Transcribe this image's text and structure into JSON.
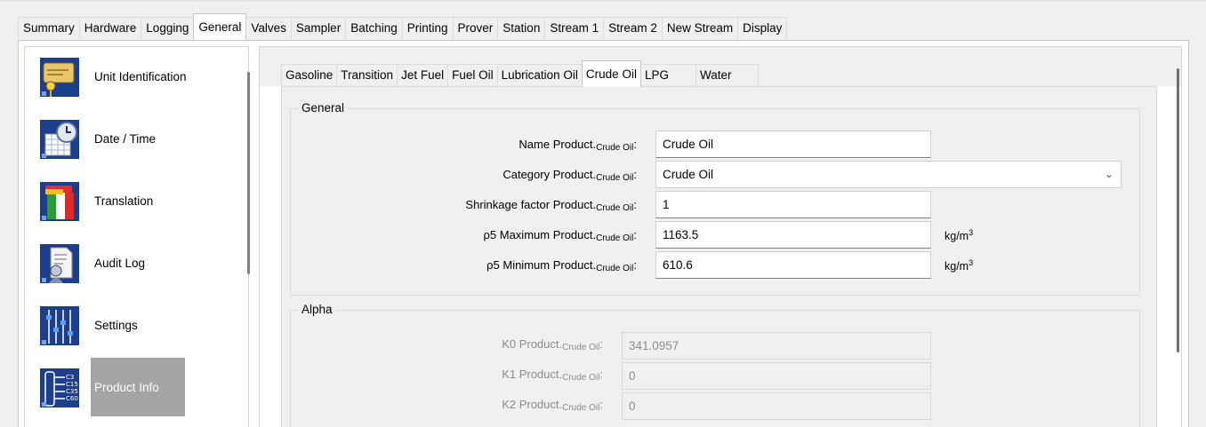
{
  "top_tabs": [
    "Summary",
    "Hardware",
    "Logging",
    "General",
    "Valves",
    "Sampler",
    "Batching",
    "Printing",
    "Prover",
    "Station",
    "Stream 1",
    "Stream 2",
    "New Stream",
    "Display"
  ],
  "active_top_tab": "General",
  "nav": [
    {
      "label": "Unit Identification",
      "icon": "unit-identification-icon"
    },
    {
      "label": "Date / Time",
      "icon": "date-time-icon"
    },
    {
      "label": "Translation",
      "icon": "translation-icon"
    },
    {
      "label": "Audit Log",
      "icon": "audit-log-icon"
    },
    {
      "label": "Settings",
      "icon": "settings-icon"
    },
    {
      "label": "Product Info",
      "icon": "product-info-icon",
      "selected": true
    }
  ],
  "sub_tabs": [
    "Gasoline",
    "Transition",
    "Jet Fuel",
    "Fuel Oil",
    "Lubrication Oil",
    "Crude Oil",
    "LPG",
    "Water"
  ],
  "active_sub_tab": "Crude Oil",
  "general": {
    "title": "General",
    "rows": [
      {
        "label": "Name Product.",
        "sub": "Crude Oil",
        "value": "Crude Oil",
        "unit": ""
      },
      {
        "label": "Category Product.",
        "sub": "Crude Oil",
        "value": "Crude Oil",
        "unit": ""
      },
      {
        "label": "Shrinkage factor Product.",
        "sub": "Crude Oil",
        "value": "1",
        "unit": ""
      },
      {
        "label": "ρ5 Maximum Product.",
        "sub": "Crude Oil",
        "value": "1163.5",
        "unit": "kg/m",
        "unit_exp": "3"
      },
      {
        "label": "ρ5 Minimum Product.",
        "sub": "Crude Oil",
        "value": "610.6",
        "unit": "kg/m",
        "unit_exp": "3"
      }
    ]
  },
  "alpha": {
    "title": "Alpha",
    "rows": [
      {
        "label": "K0 Product.",
        "sub": "Crude Oil",
        "value": "341.0957"
      },
      {
        "label": "K1 Product.",
        "sub": "Crude Oil",
        "value": "0"
      },
      {
        "label": "K2 Product.",
        "sub": "Crude Oil",
        "value": "0"
      }
    ]
  },
  "colors": {
    "selected_nav": "#a4a4a4",
    "background": "#f0f0f0"
  }
}
